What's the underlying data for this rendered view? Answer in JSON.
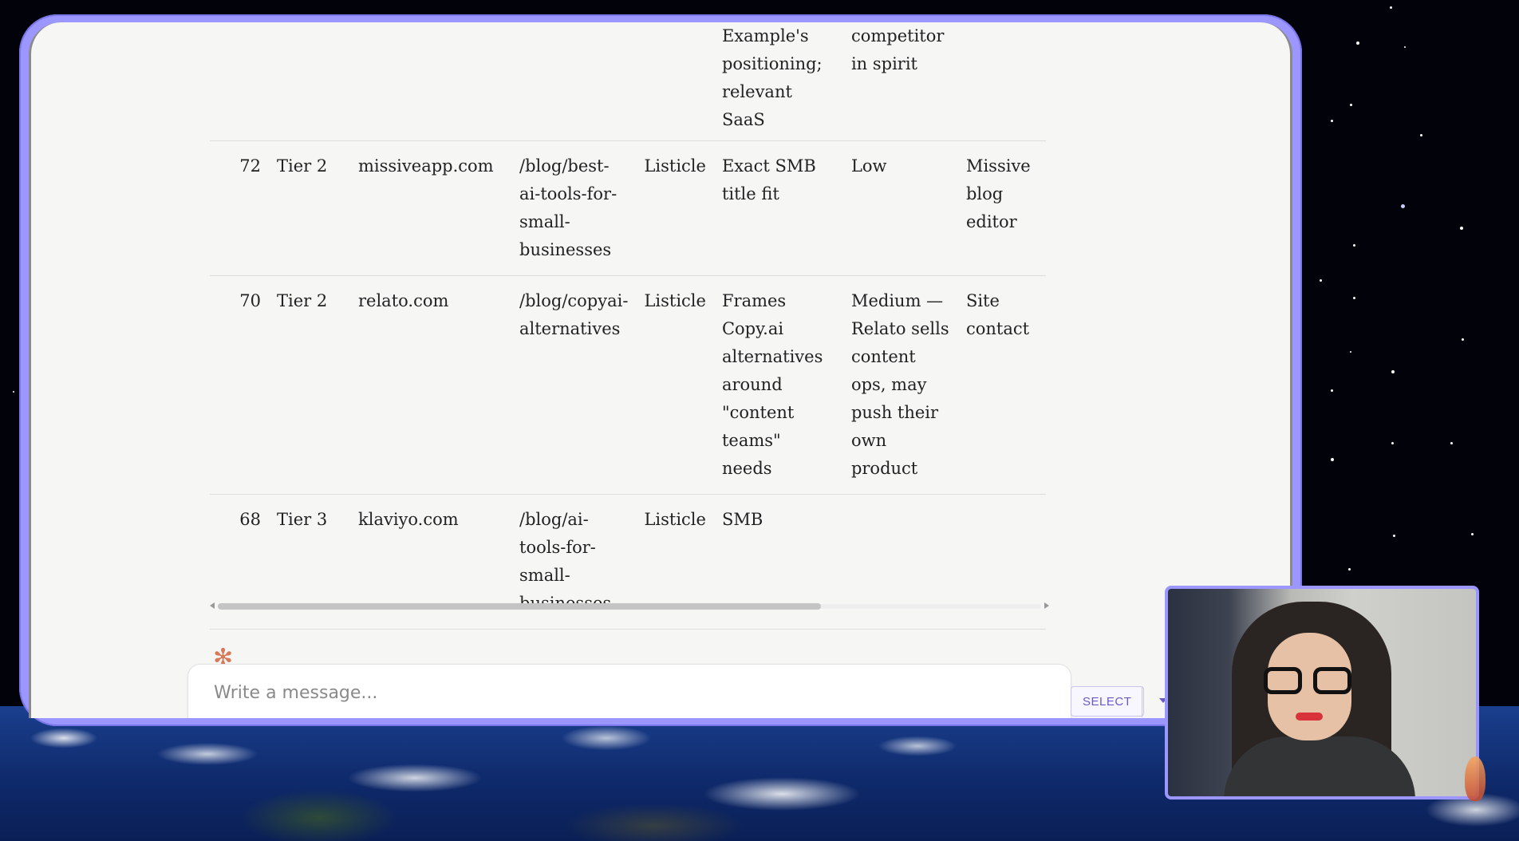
{
  "table": {
    "partial_row": {
      "fit": "Example's positioning; relevant SaaS",
      "risk": "competitor in spirit"
    },
    "rows": [
      {
        "score": "72",
        "tier": "Tier 2",
        "domain": "missiveapp.com",
        "path": "/blog/best-ai-tools-for-small-businesses",
        "type": "Listicle",
        "fit": "Exact SMB title fit",
        "risk": "Low",
        "contact": "Missive blog editor"
      },
      {
        "score": "70",
        "tier": "Tier 2",
        "domain": "relato.com",
        "path": "/blog/copyai-alternatives",
        "type": "Listicle",
        "fit": "Frames Copy.ai alternatives around \"content teams\" needs",
        "risk": "Medium — Relato sells content ops, may push their own product",
        "contact": "Site contact"
      },
      {
        "score": "68",
        "tier": "Tier 3",
        "domain": "klaviyo.com",
        "path": "/blog/ai-tools-for-small-businesses",
        "type": "Listicle",
        "fit": "SMB",
        "risk": "",
        "contact": ""
      }
    ]
  },
  "composer": {
    "placeholder": "Write a message..."
  },
  "controls": {
    "select_label": "SELECT"
  },
  "colors": {
    "window_frame": "#9b97ff",
    "accent": "#6a59c4",
    "spark": "#d8795a"
  }
}
